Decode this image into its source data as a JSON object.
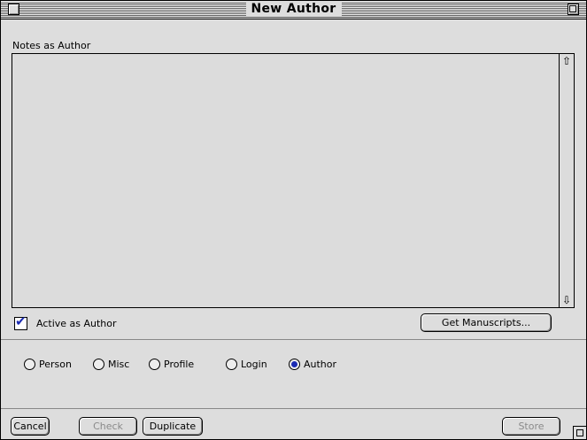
{
  "window": {
    "title": "New Author"
  },
  "notes": {
    "label": "Notes as Author",
    "value": ""
  },
  "scroll": {
    "up_glyph": "⇧",
    "down_glyph": "⇩"
  },
  "active": {
    "label": "Active as Author",
    "checked": true,
    "check_glyph": "✔"
  },
  "get_manuscripts": {
    "label": "Get Manuscripts..."
  },
  "radios": [
    {
      "label": "Person",
      "selected": false
    },
    {
      "label": "Misc",
      "selected": false
    },
    {
      "label": "Profile",
      "selected": false
    },
    {
      "label": "Login",
      "selected": false
    },
    {
      "label": "Author",
      "selected": true
    }
  ],
  "buttons": {
    "cancel": "Cancel",
    "check": "Check",
    "duplicate": "Duplicate",
    "store": "Store"
  },
  "colors": {
    "accent": "#1b2bb3",
    "background": "#dddddd"
  }
}
